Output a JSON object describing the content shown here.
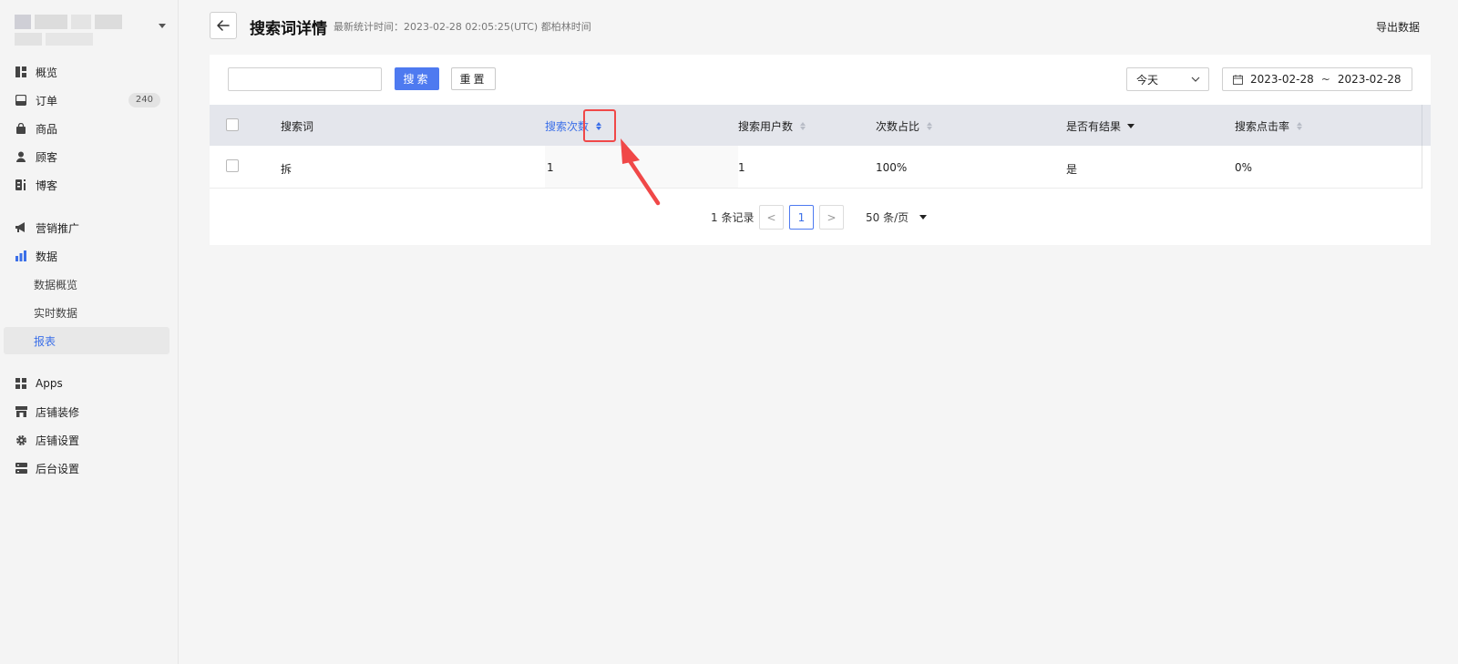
{
  "sidebar": {
    "nav": [
      {
        "label": "概览",
        "icon": "dashboard-icon"
      },
      {
        "label": "订单",
        "icon": "inbox-icon",
        "badge": "240"
      },
      {
        "label": "商品",
        "icon": "bag-icon"
      },
      {
        "label": "顾客",
        "icon": "person-icon"
      },
      {
        "label": "博客",
        "icon": "blog-icon"
      },
      {
        "label": "营销推广",
        "icon": "megaphone-icon"
      },
      {
        "label": "数据",
        "icon": "bar-chart-icon",
        "active_color": "#3b6fe8"
      },
      {
        "label": "数据概览",
        "sub": true
      },
      {
        "label": "实时数据",
        "sub": true
      },
      {
        "label": "报表",
        "sub": true,
        "active": true
      },
      {
        "label": "Apps",
        "icon": "apps-icon"
      },
      {
        "label": "店铺装修",
        "icon": "storefront-icon"
      },
      {
        "label": "店铺设置",
        "icon": "gear-icon"
      },
      {
        "label": "后台设置",
        "icon": "server-icon"
      }
    ]
  },
  "header": {
    "title": "搜索词详情",
    "stat_time": "最新统计时间：2023-02-28 02:05:25(UTC) 都柏林时间",
    "export_label": "导出数据"
  },
  "toolbar": {
    "search_value": "",
    "search_label": "搜索",
    "reset_label": "重置",
    "period": "今天",
    "date_start": "2023-02-28",
    "date_sep": "~",
    "date_end": "2023-02-28"
  },
  "table": {
    "columns": [
      "搜索词",
      "搜索次数",
      "搜索用户数",
      "次数占比",
      "是否有结果",
      "搜索点击率"
    ],
    "rows": [
      [
        "拆",
        "1",
        "1",
        "100%",
        "是",
        "0%"
      ]
    ]
  },
  "pagination": {
    "total": "1 条记录",
    "prev": "<",
    "current": "1",
    "next": ">",
    "page_size": "50 条/页"
  },
  "colors": {
    "accent": "#4e7af0",
    "annotation": "#f04848"
  }
}
